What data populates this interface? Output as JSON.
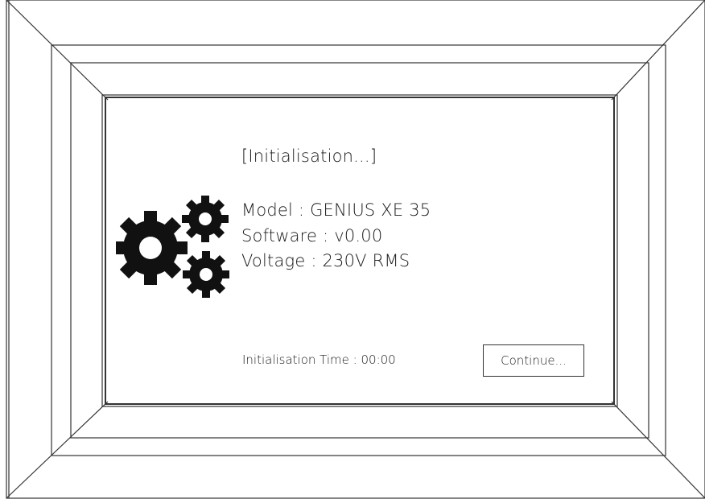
{
  "screen": {
    "title": "[Initialisation...]",
    "model_line": "Model : GENIUS XE 35",
    "software_line": "Software : v0.00",
    "voltage_line": "Voltage : 230V RMS",
    "init_time_line": "Initialisation Time : 00:00",
    "continue_label": "Continue..."
  },
  "icons": {
    "gears": "gears-icon"
  }
}
